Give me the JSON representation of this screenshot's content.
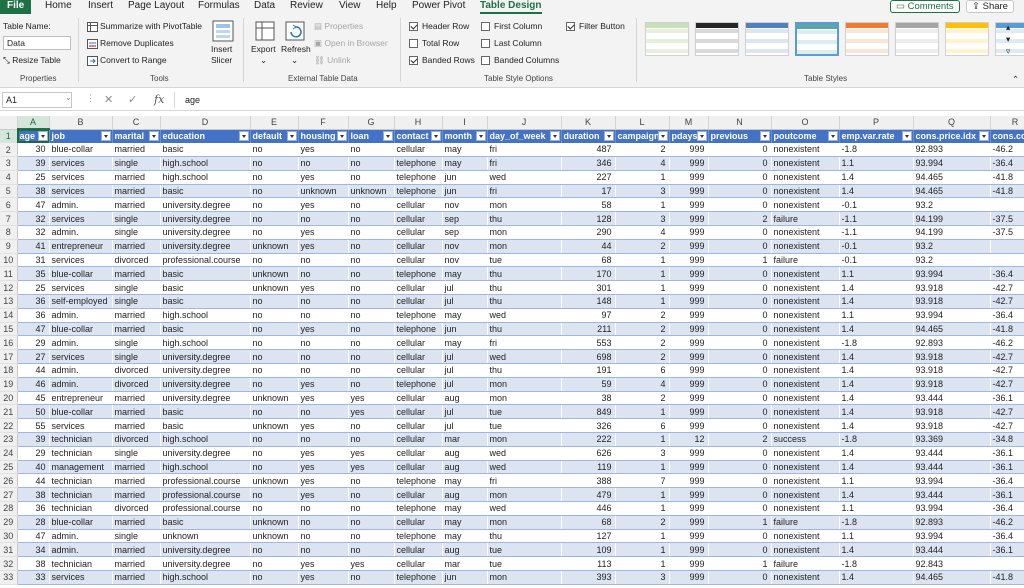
{
  "tabs": [
    "File",
    "Home",
    "Insert",
    "Page Layout",
    "Formulas",
    "Data",
    "Review",
    "View",
    "Help",
    "Power Pivot",
    "Table Design"
  ],
  "active_tab": "Table Design",
  "top_buttons": {
    "comments": "Comments",
    "share": "Share"
  },
  "ribbon": {
    "properties": {
      "table_name_label": "Table Name:",
      "table_name_value": "Data",
      "resize": "Resize Table",
      "group": "Properties"
    },
    "tools": {
      "summarize": "Summarize with PivotTable",
      "remove_dup": "Remove Duplicates",
      "convert": "Convert to Range",
      "insert_slicer_1": "Insert",
      "insert_slicer_2": "Slicer",
      "group": "Tools"
    },
    "external": {
      "export": "Export",
      "refresh": "Refresh",
      "properties": "Properties",
      "open_browser": "Open in Browser",
      "unlink": "Unlink",
      "group": "External Table Data"
    },
    "style_options": {
      "header_row": "Header Row",
      "total_row": "Total Row",
      "banded_rows": "Banded Rows",
      "first_column": "First Column",
      "last_column": "Last Column",
      "banded_columns": "Banded Columns",
      "filter_button": "Filter Button",
      "checked": {
        "header_row": true,
        "total_row": false,
        "banded_rows": true,
        "first_column": false,
        "last_column": false,
        "banded_columns": false,
        "filter_button": true
      },
      "group": "Table Style Options"
    },
    "styles": {
      "group": "Table Styles",
      "swatches": [
        {
          "head": "#c9dfb8",
          "row": "#e6f0dc"
        },
        {
          "head": "#262626",
          "row": "#d9d9d9"
        },
        {
          "head": "#4f81bd",
          "row": "#dce6f1"
        },
        {
          "head": "#5da6a7",
          "row": "#daeeee"
        },
        {
          "head": "#ed7d31",
          "row": "#fbe5d6"
        },
        {
          "head": "#a5a5a5",
          "row": "#ededed"
        },
        {
          "head": "#ffc000",
          "row": "#fff2cc"
        },
        {
          "head": "#5b9bd5",
          "row": "#deebf7"
        }
      ],
      "selected_index": 3
    }
  },
  "formula_bar": {
    "name_box": "A1",
    "cancel": "✕",
    "enter": "✓",
    "fx": "fx",
    "content": "age"
  },
  "columns": [
    "A",
    "B",
    "C",
    "D",
    "E",
    "F",
    "G",
    "H",
    "I",
    "J",
    "K",
    "L",
    "M",
    "N",
    "O",
    "P",
    "Q",
    "R"
  ],
  "selected_column": "A",
  "headers": [
    "age",
    "job",
    "marital",
    "education",
    "default",
    "housing",
    "loan",
    "contact",
    "month",
    "day_of_week",
    "duration",
    "campaign",
    "pdays",
    "previous",
    "poutcome",
    "emp.var.rate",
    "cons.price.idx",
    "cons.con"
  ],
  "numeric_columns": [
    0,
    10,
    11,
    12,
    13
  ],
  "rows": [
    [
      "30",
      "blue-collar",
      "married",
      "basic",
      "no",
      "yes",
      "no",
      "cellular",
      "may",
      "fri",
      "487",
      "2",
      "999",
      "0",
      "nonexistent",
      "-1.8",
      "92.893",
      "-46.2"
    ],
    [
      "39",
      "services",
      "single",
      "high.school",
      "no",
      "no",
      "no",
      "telephone",
      "may",
      "fri",
      "346",
      "4",
      "999",
      "0",
      "nonexistent",
      "1.1",
      "93.994",
      "-36.4"
    ],
    [
      "25",
      "services",
      "married",
      "high.school",
      "no",
      "yes",
      "no",
      "telephone",
      "jun",
      "wed",
      "227",
      "1",
      "999",
      "0",
      "nonexistent",
      "1.4",
      "94.465",
      "-41.8"
    ],
    [
      "38",
      "services",
      "married",
      "basic",
      "no",
      "unknown",
      "unknown",
      "telephone",
      "jun",
      "fri",
      "17",
      "3",
      "999",
      "0",
      "nonexistent",
      "1.4",
      "94.465",
      "-41.8"
    ],
    [
      "47",
      "admin.",
      "married",
      "university.degree",
      "no",
      "yes",
      "no",
      "cellular",
      "nov",
      "mon",
      "58",
      "1",
      "999",
      "0",
      "nonexistent",
      "-0.1",
      "93.2",
      ""
    ],
    [
      "32",
      "services",
      "single",
      "university.degree",
      "no",
      "no",
      "no",
      "cellular",
      "sep",
      "thu",
      "128",
      "3",
      "999",
      "2",
      "failure",
      "-1.1",
      "94.199",
      "-37.5"
    ],
    [
      "32",
      "admin.",
      "single",
      "university.degree",
      "no",
      "yes",
      "no",
      "cellular",
      "sep",
      "mon",
      "290",
      "4",
      "999",
      "0",
      "nonexistent",
      "-1.1",
      "94.199",
      "-37.5"
    ],
    [
      "41",
      "entrepreneur",
      "married",
      "university.degree",
      "unknown",
      "yes",
      "no",
      "cellular",
      "nov",
      "mon",
      "44",
      "2",
      "999",
      "0",
      "nonexistent",
      "-0.1",
      "93.2",
      ""
    ],
    [
      "31",
      "services",
      "divorced",
      "professional.course",
      "no",
      "no",
      "no",
      "cellular",
      "nov",
      "tue",
      "68",
      "1",
      "999",
      "1",
      "failure",
      "-0.1",
      "93.2",
      ""
    ],
    [
      "35",
      "blue-collar",
      "married",
      "basic",
      "unknown",
      "no",
      "no",
      "telephone",
      "may",
      "thu",
      "170",
      "1",
      "999",
      "0",
      "nonexistent",
      "1.1",
      "93.994",
      "-36.4"
    ],
    [
      "25",
      "services",
      "single",
      "basic",
      "unknown",
      "yes",
      "no",
      "cellular",
      "jul",
      "thu",
      "301",
      "1",
      "999",
      "0",
      "nonexistent",
      "1.4",
      "93.918",
      "-42.7"
    ],
    [
      "36",
      "self-employed",
      "single",
      "basic",
      "no",
      "no",
      "no",
      "cellular",
      "jul",
      "thu",
      "148",
      "1",
      "999",
      "0",
      "nonexistent",
      "1.4",
      "93.918",
      "-42.7"
    ],
    [
      "36",
      "admin.",
      "married",
      "high.school",
      "no",
      "no",
      "no",
      "telephone",
      "may",
      "wed",
      "97",
      "2",
      "999",
      "0",
      "nonexistent",
      "1.1",
      "93.994",
      "-36.4"
    ],
    [
      "47",
      "blue-collar",
      "married",
      "basic",
      "no",
      "yes",
      "no",
      "telephone",
      "jun",
      "thu",
      "211",
      "2",
      "999",
      "0",
      "nonexistent",
      "1.4",
      "94.465",
      "-41.8"
    ],
    [
      "29",
      "admin.",
      "single",
      "high.school",
      "no",
      "no",
      "no",
      "cellular",
      "may",
      "fri",
      "553",
      "2",
      "999",
      "0",
      "nonexistent",
      "-1.8",
      "92.893",
      "-46.2"
    ],
    [
      "27",
      "services",
      "single",
      "university.degree",
      "no",
      "no",
      "no",
      "cellular",
      "jul",
      "wed",
      "698",
      "2",
      "999",
      "0",
      "nonexistent",
      "1.4",
      "93.918",
      "-42.7"
    ],
    [
      "44",
      "admin.",
      "divorced",
      "university.degree",
      "no",
      "no",
      "no",
      "cellular",
      "jul",
      "thu",
      "191",
      "6",
      "999",
      "0",
      "nonexistent",
      "1.4",
      "93.918",
      "-42.7"
    ],
    [
      "46",
      "admin.",
      "divorced",
      "university.degree",
      "no",
      "yes",
      "no",
      "telephone",
      "jul",
      "mon",
      "59",
      "4",
      "999",
      "0",
      "nonexistent",
      "1.4",
      "93.918",
      "-42.7"
    ],
    [
      "45",
      "entrepreneur",
      "married",
      "university.degree",
      "unknown",
      "yes",
      "yes",
      "cellular",
      "aug",
      "mon",
      "38",
      "2",
      "999",
      "0",
      "nonexistent",
      "1.4",
      "93.444",
      "-36.1"
    ],
    [
      "50",
      "blue-collar",
      "married",
      "basic",
      "no",
      "no",
      "yes",
      "cellular",
      "jul",
      "tue",
      "849",
      "1",
      "999",
      "0",
      "nonexistent",
      "1.4",
      "93.918",
      "-42.7"
    ],
    [
      "55",
      "services",
      "married",
      "basic",
      "unknown",
      "yes",
      "no",
      "cellular",
      "jul",
      "tue",
      "326",
      "6",
      "999",
      "0",
      "nonexistent",
      "1.4",
      "93.918",
      "-42.7"
    ],
    [
      "39",
      "technician",
      "divorced",
      "high.school",
      "no",
      "no",
      "no",
      "cellular",
      "mar",
      "mon",
      "222",
      "1",
      "12",
      "2",
      "success",
      "-1.8",
      "93.369",
      "-34.8"
    ],
    [
      "29",
      "technician",
      "single",
      "university.degree",
      "no",
      "yes",
      "yes",
      "cellular",
      "aug",
      "wed",
      "626",
      "3",
      "999",
      "0",
      "nonexistent",
      "1.4",
      "93.444",
      "-36.1"
    ],
    [
      "40",
      "management",
      "married",
      "high.school",
      "no",
      "yes",
      "yes",
      "cellular",
      "aug",
      "wed",
      "119",
      "1",
      "999",
      "0",
      "nonexistent",
      "1.4",
      "93.444",
      "-36.1"
    ],
    [
      "44",
      "technician",
      "married",
      "professional.course",
      "unknown",
      "yes",
      "no",
      "telephone",
      "may",
      "fri",
      "388",
      "7",
      "999",
      "0",
      "nonexistent",
      "1.1",
      "93.994",
      "-36.4"
    ],
    [
      "38",
      "technician",
      "married",
      "professional.course",
      "no",
      "yes",
      "no",
      "cellular",
      "aug",
      "mon",
      "479",
      "1",
      "999",
      "0",
      "nonexistent",
      "1.4",
      "93.444",
      "-36.1"
    ],
    [
      "36",
      "technician",
      "divorced",
      "professional.course",
      "no",
      "no",
      "no",
      "telephone",
      "may",
      "wed",
      "446",
      "1",
      "999",
      "0",
      "nonexistent",
      "1.1",
      "93.994",
      "-36.4"
    ],
    [
      "28",
      "blue-collar",
      "married",
      "basic",
      "unknown",
      "no",
      "no",
      "cellular",
      "may",
      "mon",
      "68",
      "2",
      "999",
      "1",
      "failure",
      "-1.8",
      "92.893",
      "-46.2"
    ],
    [
      "47",
      "admin.",
      "single",
      "unknown",
      "unknown",
      "no",
      "no",
      "telephone",
      "may",
      "thu",
      "127",
      "1",
      "999",
      "0",
      "nonexistent",
      "1.1",
      "93.994",
      "-36.4"
    ],
    [
      "34",
      "admin.",
      "married",
      "university.degree",
      "no",
      "no",
      "no",
      "cellular",
      "aug",
      "tue",
      "109",
      "1",
      "999",
      "0",
      "nonexistent",
      "1.4",
      "93.444",
      "-36.1"
    ],
    [
      "38",
      "technician",
      "married",
      "university.degree",
      "no",
      "yes",
      "yes",
      "cellular",
      "mar",
      "tue",
      "113",
      "1",
      "999",
      "1",
      "failure",
      "-1.8",
      "92.843",
      ""
    ],
    [
      "33",
      "services",
      "married",
      "high.school",
      "no",
      "yes",
      "no",
      "telephone",
      "jun",
      "mon",
      "393",
      "3",
      "999",
      "0",
      "nonexistent",
      "1.4",
      "94.465",
      "-41.8"
    ]
  ]
}
